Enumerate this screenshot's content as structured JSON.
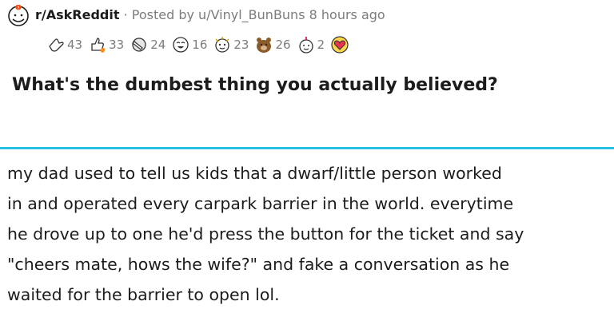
{
  "post": {
    "subreddit": "r/AskReddit",
    "separator": "·",
    "posted_by": "Posted by u/Vinyl_BunBuns",
    "time_ago": "8 hours ago",
    "title": "What's the dumbest thing you actually believed?"
  },
  "awards": [
    {
      "icon": "hand-wave-award-icon",
      "count": "43"
    },
    {
      "icon": "thumbs-up-fire-award-icon",
      "count": "33"
    },
    {
      "icon": "facepalm-award-icon",
      "count": "24"
    },
    {
      "icon": "laughing-face-award-icon",
      "count": "16"
    },
    {
      "icon": "wholesome-face-award-icon",
      "count": "23"
    },
    {
      "icon": "bear-award-icon",
      "count": "26"
    },
    {
      "icon": "cake-face-award-icon",
      "count": "2"
    },
    {
      "icon": "heart-award-icon",
      "count": ""
    }
  ],
  "comment": {
    "lines": [
      "my dad used to tell us kids that a dwarf/little person worked",
      "in and operated every carpark barrier in the world. everytime",
      "he drove up to one he'd press the button for the ticket and say",
      "\"cheers mate, hows the wife?\" and fake a conversation as he",
      "waited for the barrier to open lol."
    ]
  },
  "colors": {
    "divider": "#25c1e3",
    "text": "#1c1c1c",
    "meta": "#7c7c7c"
  }
}
